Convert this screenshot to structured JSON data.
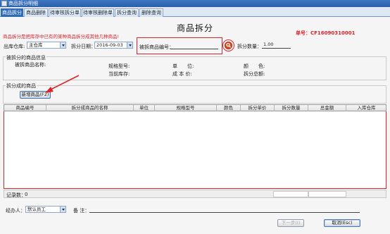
{
  "window": {
    "title": "商品拆分明细"
  },
  "tabs": [
    "商品拆分",
    "商品删除",
    "待审核拆分单",
    "待审核删除单",
    "拆分查询",
    "删除查询"
  ],
  "page": {
    "title": "商品拆分",
    "order_label": "单号：CF16090310001",
    "hint": "商品拆分是把库存中已有的某种商品拆分成其他几种商品!"
  },
  "form": {
    "warehouse_label": "出库仓库:",
    "warehouse_value": "主仓库",
    "date_label": "拆分日期：",
    "date_value": "2016-09-03",
    "code_label": "被拆商品编号：",
    "code_value": "",
    "qty_label": "拆分数量：",
    "qty_value": "1.00"
  },
  "info": {
    "title": "被拆分的商品信息",
    "name_label": "被拆商品名称:",
    "spec_label": "规格型号:",
    "unit_label": "单　　位:",
    "color_label": "颜　　色:",
    "stock_label": "当前库存:",
    "cost_label": "成 本 价:",
    "total_label": "拆分总额:"
  },
  "split": {
    "title": "拆分成的商品",
    "add_button": "新增商品(F2)"
  },
  "grid": {
    "columns": [
      "商品编号",
      "拆分成商品的名称",
      "单位",
      "规格型号",
      "颜色",
      "拆分单价",
      "拆分数量",
      "总金额",
      "入库仓库"
    ]
  },
  "records": {
    "label": "记录数：",
    "count": "0"
  },
  "footer": {
    "handler_label": "经办人：",
    "handler_value": "默认员工",
    "remark_label": "备 注：",
    "remark_value": "",
    "prev_button": "下一步(I)",
    "cancel_button": "取消(Esc)"
  },
  "colors": {
    "accent": "#2f6cb5",
    "warning": "#e0222b"
  }
}
